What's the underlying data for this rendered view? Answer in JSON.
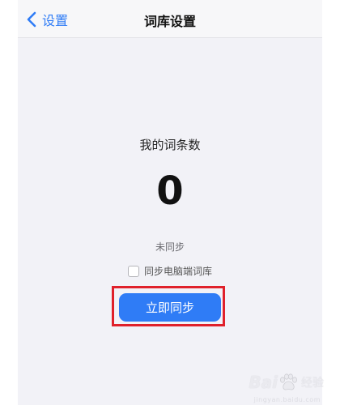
{
  "nav": {
    "back_label": "设置",
    "title": "词库设置"
  },
  "main": {
    "count_label": "我的词条数",
    "count_value": "0",
    "sync_status": "未同步",
    "sync_pc_label": "同步电脑端词库",
    "sync_pc_checked": false,
    "sync_button_label": "立即同步"
  },
  "watermark": {
    "brand_left": "Bai",
    "brand_right": "经验",
    "url": "jingyan.baidu.com"
  },
  "colors": {
    "accent": "#2f7cf6",
    "highlight": "#e0212b",
    "background": "#f2f2f7"
  },
  "icons": {
    "back": "chevron-left-icon",
    "watermark_logo": "baidu-paw-icon"
  }
}
